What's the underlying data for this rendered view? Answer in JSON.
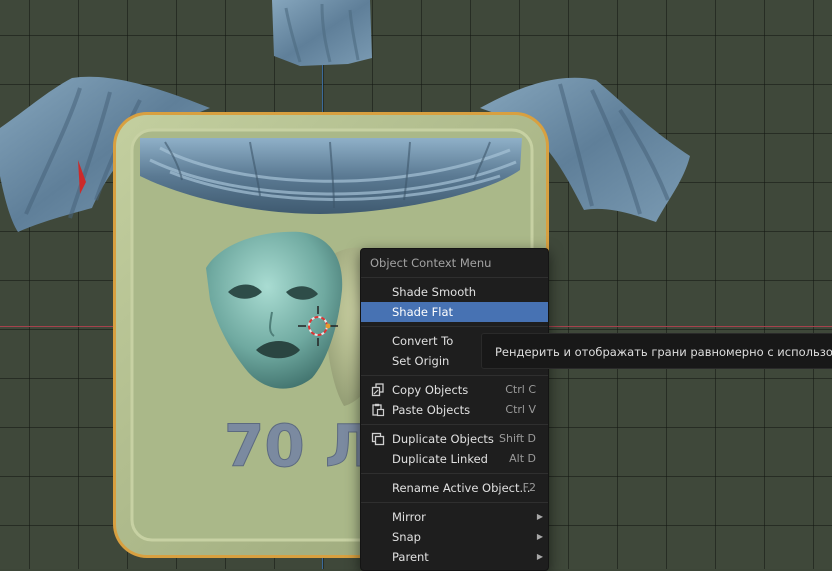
{
  "scene": {
    "embossed_text": "70 Л"
  },
  "context_menu": {
    "title": "Object Context Menu",
    "items": [
      {
        "label": "Shade Smooth",
        "shortcut": "",
        "submenu": false,
        "icon": "",
        "active": false
      },
      {
        "label": "Shade Flat",
        "shortcut": "",
        "submenu": false,
        "icon": "",
        "active": true
      },
      {
        "label": "Convert To",
        "shortcut": "",
        "submenu": false,
        "icon": ""
      },
      {
        "label": "Set Origin",
        "shortcut": "",
        "submenu": false,
        "icon": ""
      },
      {
        "label": "Copy Objects",
        "shortcut": "Ctrl C",
        "submenu": false,
        "icon": "copy-icon"
      },
      {
        "label": "Paste Objects",
        "shortcut": "Ctrl V",
        "submenu": false,
        "icon": "paste-icon"
      },
      {
        "label": "Duplicate Objects",
        "shortcut": "Shift D",
        "submenu": false,
        "icon": "duplicate-icon"
      },
      {
        "label": "Duplicate Linked",
        "shortcut": "Alt D",
        "submenu": false,
        "icon": ""
      },
      {
        "label": "Rename Active Object...",
        "shortcut": "F2",
        "submenu": false,
        "icon": ""
      },
      {
        "label": "Mirror",
        "shortcut": "",
        "submenu": true,
        "icon": ""
      },
      {
        "label": "Snap",
        "shortcut": "",
        "submenu": true,
        "icon": ""
      },
      {
        "label": "Parent",
        "shortcut": "",
        "submenu": true,
        "icon": ""
      }
    ]
  },
  "tooltip": {
    "text": "Рендерить и отображать грани равномерно с использованием"
  },
  "colors": {
    "menu_bg": "#1e1e1e",
    "highlight": "#4772b3",
    "selection_outline": "#e8a23a",
    "plaque": "#a9b58a",
    "drapery": "#6d8fa8",
    "mask": "#7fb7ae"
  }
}
